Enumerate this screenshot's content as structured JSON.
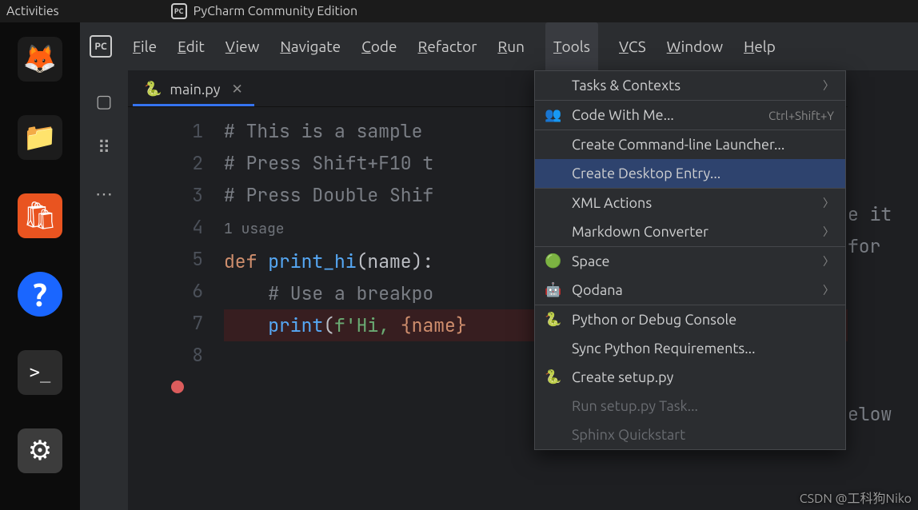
{
  "os_topbar": {
    "activities": "Activities",
    "app_title": "PyCharm Community Edition"
  },
  "dock": [
    {
      "id": "firefox",
      "glyph": "🦊",
      "bg": "#1c1c1c"
    },
    {
      "id": "files",
      "glyph": "📁",
      "bg": "#1c1c1c"
    },
    {
      "id": "software",
      "glyph": "🛍",
      "bg": "#e95420"
    },
    {
      "id": "help",
      "glyph": "?",
      "bg": "#1a66ff"
    },
    {
      "id": "terminal",
      "glyph": ">_",
      "bg": "#2c2c2c"
    },
    {
      "id": "settings",
      "glyph": "⚙",
      "bg": "#3c3c3c"
    }
  ],
  "menubar": [
    "File",
    "Edit",
    "View",
    "Navigate",
    "Code",
    "Refactor",
    "Run",
    "Tools",
    "VCS",
    "Window",
    "Help"
  ],
  "active_menu": "Tools",
  "tab": {
    "filename": "main.py",
    "icon": "python"
  },
  "code_lines": [
    {
      "n": 1,
      "type": "comment",
      "text": "# This is a sample "
    },
    {
      "n": 2,
      "type": "blank",
      "text": ""
    },
    {
      "n": 3,
      "type": "comment",
      "text": "# Press Shift+F10 t"
    },
    {
      "n": 4,
      "type": "comment",
      "text": "# Press Double Shif"
    },
    {
      "n": 5,
      "type": "blank",
      "text": ""
    },
    {
      "n": 6,
      "type": "blank",
      "text": ""
    },
    {
      "n": "",
      "type": "usage",
      "text": "1 usage"
    },
    {
      "n": 7,
      "type": "def",
      "def_kw": "def ",
      "fn": "print_hi",
      "rest": "(name):"
    },
    {
      "n": 8,
      "type": "comment_indent",
      "text": "    # Use a breakpo"
    },
    {
      "n": "",
      "type": "bp_print",
      "bp": true,
      "fn": "print",
      "open": "(",
      "s1": "f'Hi, ",
      "tp": "{name}"
    }
  ],
  "right_peek": {
    "l3": "e it ",
    "l4": "for ",
    "l8": "elow "
  },
  "dropdown": [
    {
      "label": "Tasks & Contexts",
      "u": "T",
      "submenu": true
    },
    {
      "label": "Code With Me...",
      "icon": "👥",
      "shortcut": "Ctrl+Shift+Y",
      "sep": true
    },
    {
      "label": "Create Command-line Launcher...",
      "sep": true
    },
    {
      "label": "Create Desktop Entry...",
      "selected": true
    },
    {
      "label": "XML Actions",
      "submenu": true,
      "sep": true
    },
    {
      "label": "Markdown Converter",
      "submenu": true
    },
    {
      "label": "Space",
      "icon": "🟢",
      "submenu": true,
      "sep": true
    },
    {
      "label": "Qodana",
      "icon": "🤖",
      "submenu": true
    },
    {
      "label": "Python or Debug Console",
      "icon": "🐍",
      "sep": true
    },
    {
      "label": "Sync Python Requirements..."
    },
    {
      "label": "Create setup.py",
      "icon": "🐍"
    },
    {
      "label": "Run setup.py Task...",
      "disabled": true
    },
    {
      "label": "Sphinx Quickstart",
      "disabled": true
    }
  ],
  "watermark": "CSDN @工科狗Niko"
}
